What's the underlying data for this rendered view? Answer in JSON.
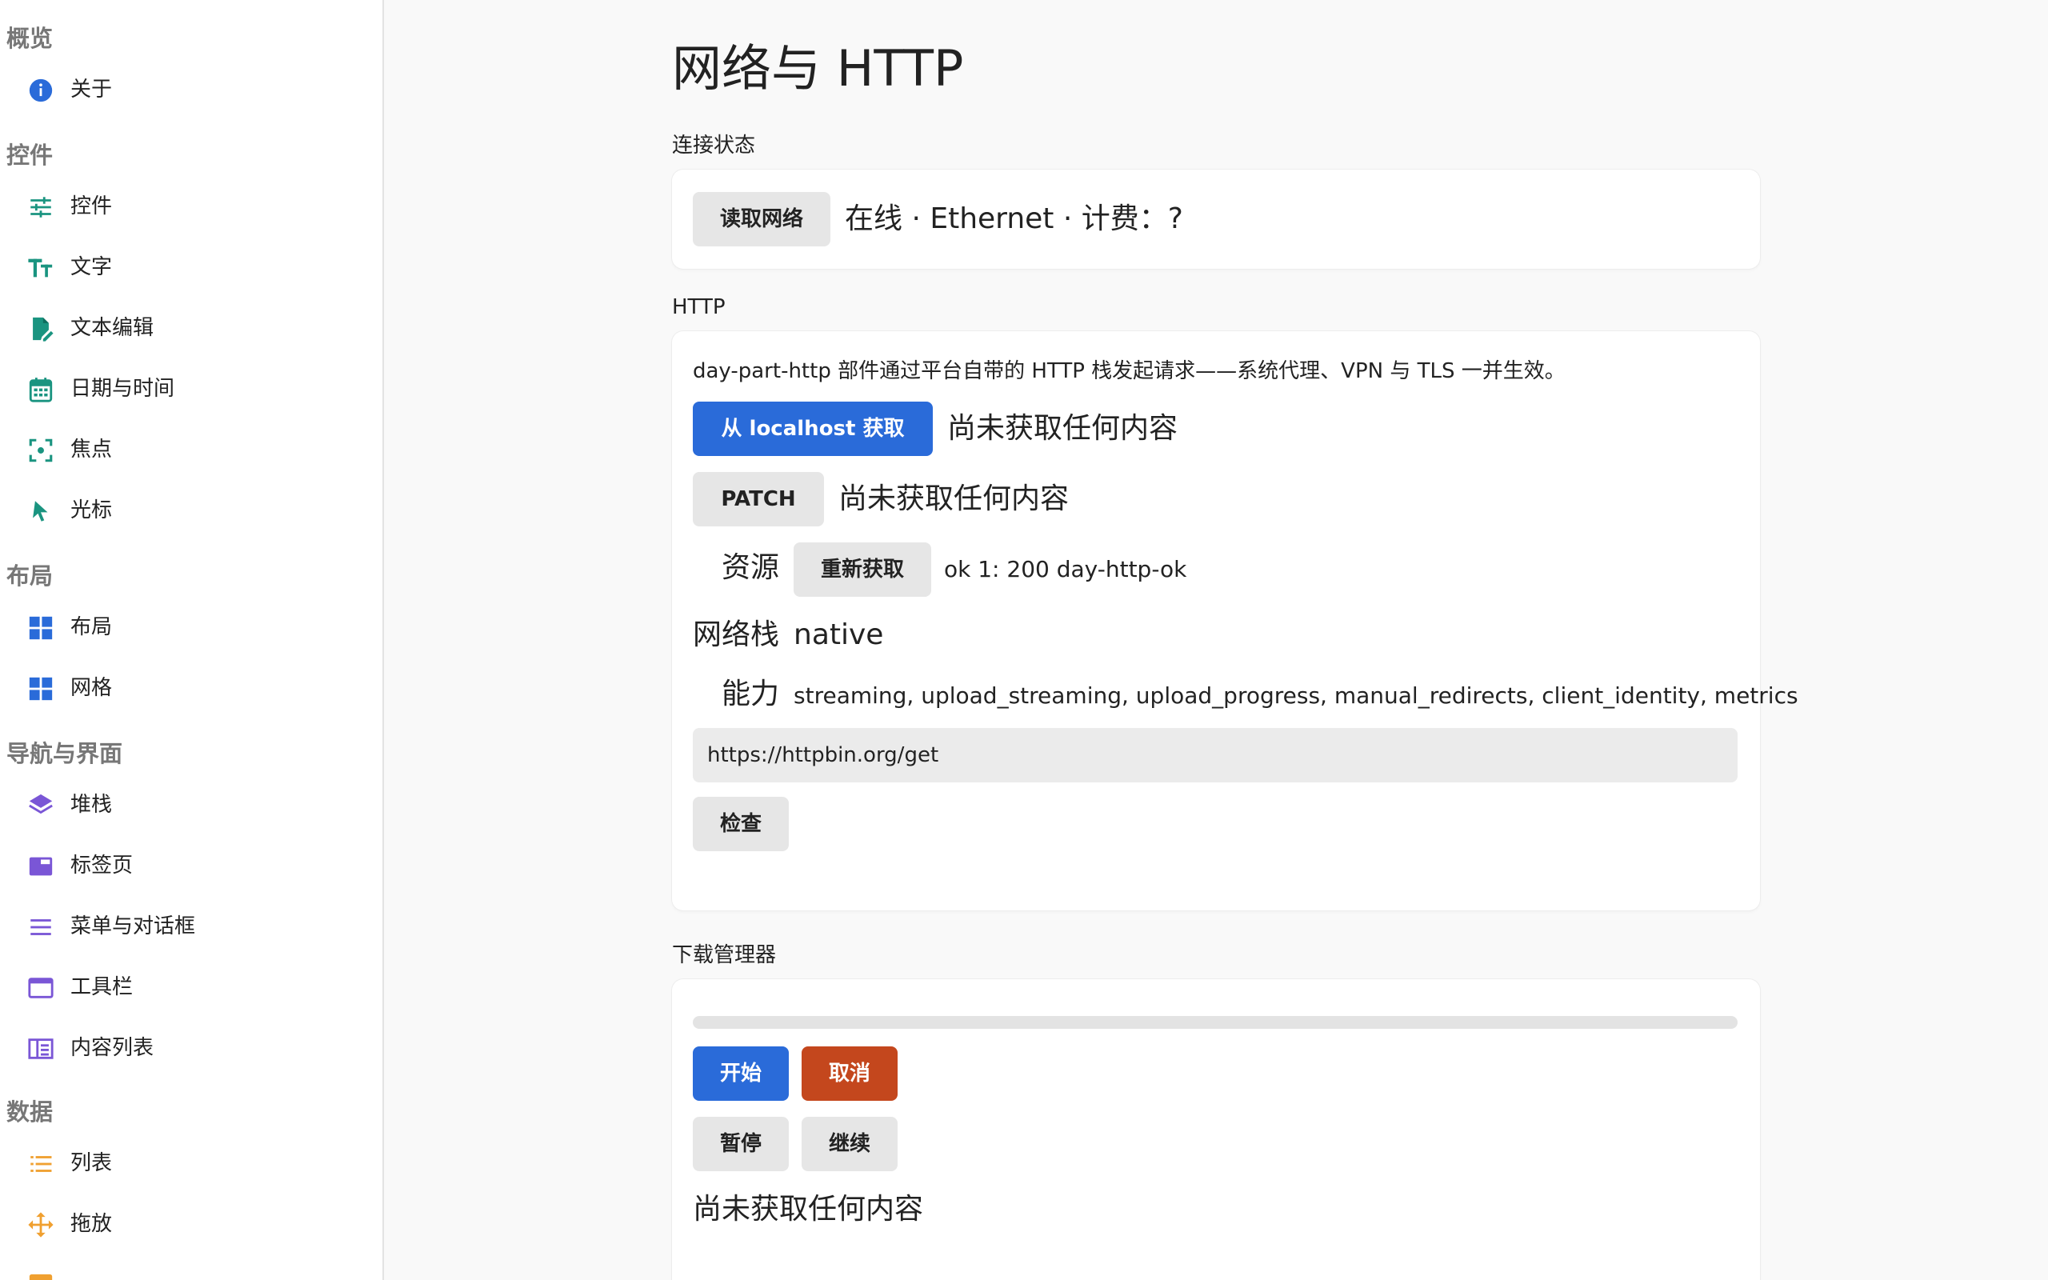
{
  "sidebar": {
    "groups": [
      {
        "title": "概览",
        "items": [
          {
            "label": "关于",
            "icon": "info-icon"
          }
        ]
      },
      {
        "title": "控件",
        "items": [
          {
            "label": "控件",
            "icon": "sliders-icon"
          },
          {
            "label": "文字",
            "icon": "text-size-icon"
          },
          {
            "label": "文本编辑",
            "icon": "edit-document-icon"
          },
          {
            "label": "日期与时间",
            "icon": "calendar-icon"
          },
          {
            "label": "焦点",
            "icon": "focus-icon"
          },
          {
            "label": "光标",
            "icon": "cursor-icon"
          }
        ]
      },
      {
        "title": "布局",
        "items": [
          {
            "label": "布局",
            "icon": "layout-grid-icon"
          },
          {
            "label": "网格",
            "icon": "grid-icon"
          }
        ]
      },
      {
        "title": "导航与界面",
        "items": [
          {
            "label": "堆栈",
            "icon": "layers-icon"
          },
          {
            "label": "标签页",
            "icon": "tab-icon"
          },
          {
            "label": "菜单与对话框",
            "icon": "menu-icon"
          },
          {
            "label": "工具栏",
            "icon": "toolbar-icon"
          },
          {
            "label": "内容列表",
            "icon": "content-list-icon"
          }
        ]
      },
      {
        "title": "数据",
        "items": [
          {
            "label": "列表",
            "icon": "list-icon"
          },
          {
            "label": "拖放",
            "icon": "drag-move-icon"
          }
        ]
      }
    ]
  },
  "main": {
    "title": "网络与 HTTP",
    "connection": {
      "label": "连接状态",
      "button": "读取网络",
      "status": "在线 · Ethernet · 计费：?"
    },
    "http": {
      "label": "HTTP",
      "description": "day-part-http 部件通过平台自带的 HTTP 栈发起请求——系统代理、VPN 与 TLS 一并生效。",
      "fetch_button": "从 localhost 获取",
      "fetch_result": "尚未获取任何内容",
      "patch_button": "PATCH",
      "patch_result": "尚未获取任何内容",
      "resource_label": "资源",
      "refetch_button": "重新获取",
      "resource_value": "ok 1: 200 day-http-ok",
      "stack_label": "网络栈",
      "stack_value": "native",
      "capability_label": "能力",
      "capability_value": "streaming, upload_streaming, upload_progress, manual_redirects, client_identity, metrics",
      "url_value": "https://httpbin.org/get",
      "inspect_button": "检查"
    },
    "download": {
      "label": "下载管理器",
      "progress": 0,
      "start_button": "开始",
      "cancel_button": "取消",
      "pause_button": "暂停",
      "resume_button": "继续",
      "result": "尚未获取任何内容"
    }
  },
  "colors": {
    "accent": "#2a6bd9",
    "danger": "#c4471d",
    "teal": "#1a9480",
    "blue": "#2a6bd9",
    "purple": "#7a56d6",
    "orange": "#f0a030"
  }
}
